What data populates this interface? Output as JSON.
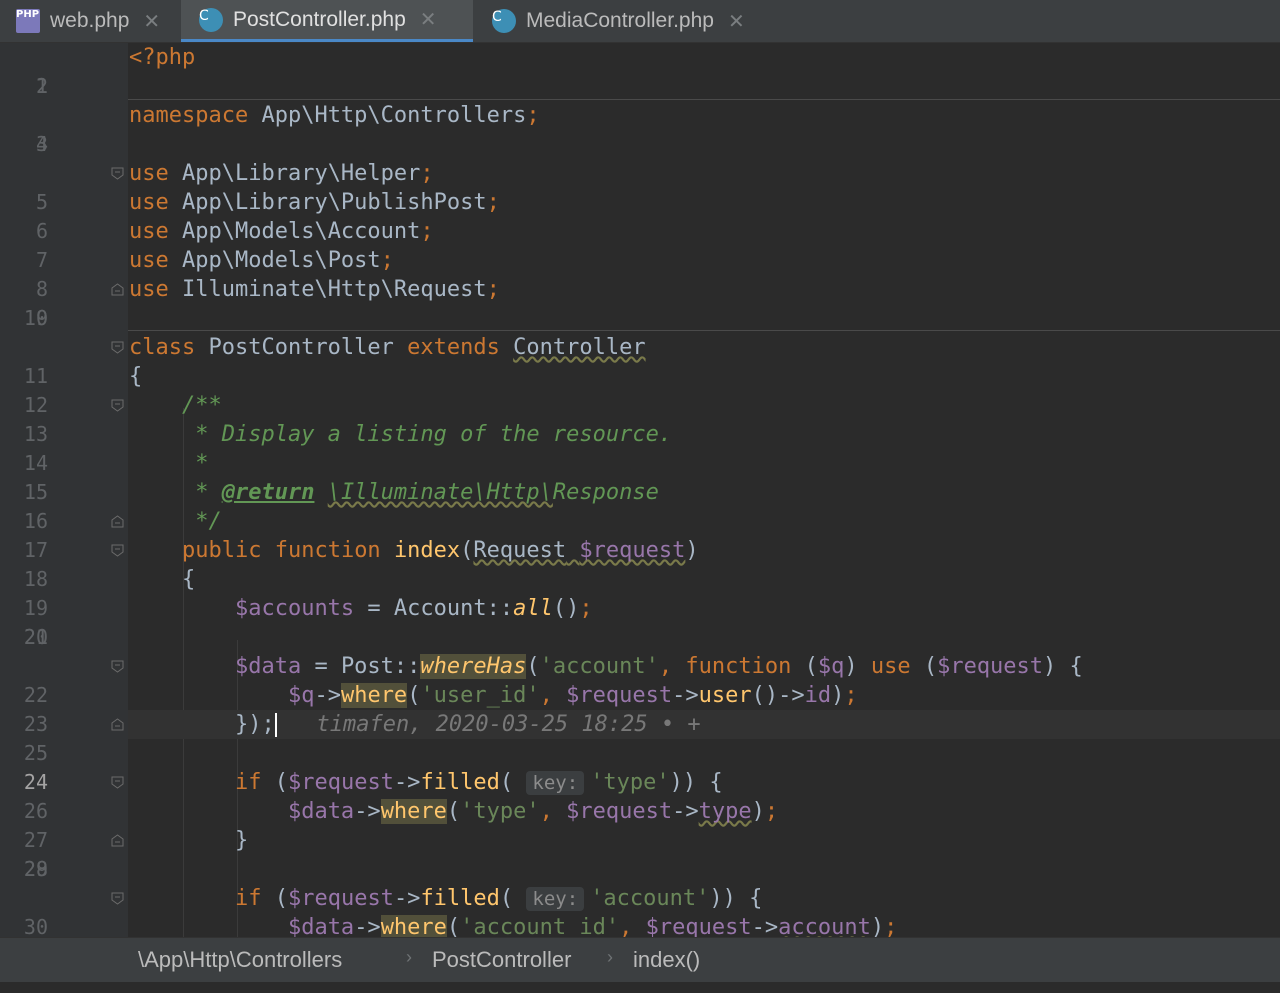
{
  "tabs": [
    {
      "label": "web.php",
      "icon": "php-file-icon",
      "active": false
    },
    {
      "label": "PostController.php",
      "icon": "class-file-icon",
      "active": true
    },
    {
      "label": "MediaController.php",
      "icon": "class-file-icon",
      "active": false
    }
  ],
  "icons": {
    "php_badge": "PHP",
    "class_badge": "C",
    "close": "✕"
  },
  "code": {
    "l1": "<?php",
    "l3_kw": "namespace",
    "l3_ns": " App\\Http\\Controllers",
    "use_kw": "use",
    "l5": " App\\Library\\Helper",
    "l6": " App\\Library\\PublishPost",
    "l7": " App\\Models\\Account",
    "l8": " App\\Models\\Post",
    "l9": " Illuminate\\Http\\Request",
    "l11_class": "class",
    "l11_name": " PostController ",
    "l11_extends": "extends",
    "l11_parent": "Controller",
    "brace_open": "{",
    "brace_close": "}",
    "l13": "/**",
    "l14": " * Display a listing of the resource.",
    "l15": " *",
    "l16_star": " * ",
    "l16_tag": "@return",
    "l16_type": "\\Illuminate\\Http\\",
    "l16_type2": "Response",
    "l17": " */",
    "l18_public": "public",
    "l18_function": "function",
    "l18_name": "index",
    "l18_type": "Request",
    "l18_var": "$request",
    "l20_var": "$accounts",
    "l20_eq": " = Account::",
    "l20_fn": "all",
    "l20_end": "()",
    "l22_var": "$data",
    "l22_eq": " = Post::",
    "l22_fn": "whereHas",
    "l22_str": "'account'",
    "l22_function": "function",
    "l22_q": "$q",
    "l22_use": "use",
    "l22_req": "$request",
    "l23_q": "$q",
    "l23_arrow": "->",
    "l23_fn": "where",
    "l23_str": "'user_id'",
    "l23_req": "$request",
    "l23_user": "user",
    "l23_rest": "()->",
    "l23_id": "id",
    "l24": "});",
    "blame": "timafen, 2020-03-25 18:25 • +",
    "if_kw": "if",
    "req": "$request",
    "filled": "filled",
    "hint_key": "key:",
    "l26_str": "'type'",
    "data_var": "$data",
    "where": "where",
    "l27_str": "'type'",
    "l27_prop": "type",
    "l30_str": "'account'",
    "l31_str": "'account_id'",
    "l31_prop": "account"
  },
  "breadcrumbs": [
    "\\App\\Http\\Controllers",
    "PostController",
    "index()"
  ],
  "breadcrumb_separator": "›"
}
